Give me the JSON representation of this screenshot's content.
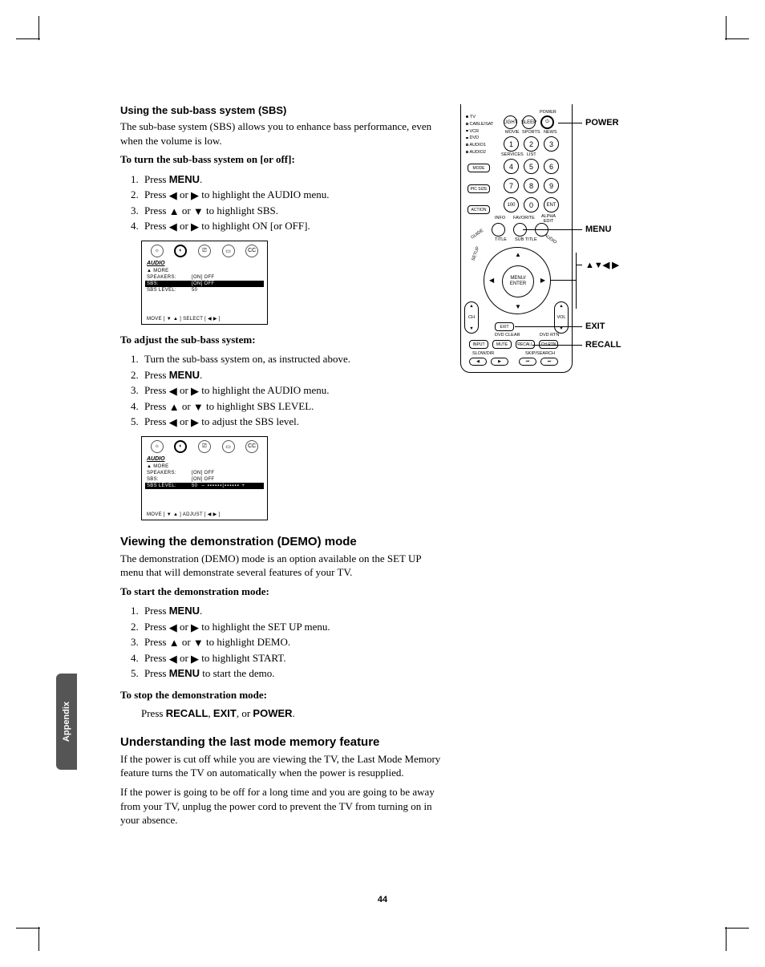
{
  "side_tab": "Appendix",
  "page_number": "44",
  "sbs": {
    "heading": "Using the sub-bass system (SBS)",
    "intro": "The sub-base system (SBS) allows you to enhance bass performance, even when the volume is low.",
    "turn_on_lead": "To turn the sub-bass system on [or off]:",
    "steps_on": {
      "s1a": "Press ",
      "s1b": "MENU",
      "s1c": ".",
      "s2a": "Press ",
      "s2b": " or ",
      "s2c": " to highlight the AUDIO menu.",
      "s3a": "Press ",
      "s3b": " or ",
      "s3c": " to highlight SBS.",
      "s4a": "Press ",
      "s4b": " or ",
      "s4c": " to highlight ON [or OFF]."
    },
    "adjust_lead": "To adjust the sub-bass system:",
    "steps_adj": {
      "s1": "Turn the sub-bass system on, as instructed above.",
      "s2a": "Press ",
      "s2b": "MENU",
      "s2c": ".",
      "s3a": "Press ",
      "s3b": " or ",
      "s3c": " to highlight the AUDIO menu.",
      "s4a": "Press ",
      "s4b": " or ",
      "s4c": " to highlight SBS LEVEL.",
      "s5a": "Press ",
      "s5b": " or ",
      "s5c": " to adjust the SBS level."
    }
  },
  "menu1": {
    "title": "AUDIO",
    "more": "▲ MORE",
    "r1l": "SPEAKERS:",
    "r1v": "[ON] OFF",
    "r2l": "SBS:",
    "r2v": "[ON] OFF",
    "r3l": "SBS LEVEL:",
    "r3v": "50",
    "foot": "MOVE [ ▼ ▲ ]   SELECT [ ◀ ▶ ]"
  },
  "menu2": {
    "title": "AUDIO",
    "more": "▲ MORE",
    "r1l": "SPEAKERS:",
    "r1v": "[ON] OFF",
    "r2l": "SBS:",
    "r2v": "[ON] OFF",
    "r3l": "SBS LEVEL:",
    "r3v": "50",
    "foot": "MOVE [ ▼ ▲ ]   ADJUST [ ◀ ▶ ]"
  },
  "demo": {
    "heading": "Viewing the demonstration (DEMO) mode",
    "intro": "The demonstration (DEMO) mode is an option available on the SET UP menu that will demonstrate several features of your TV.",
    "start_lead": "To start the demonstration mode:",
    "steps": {
      "s1a": "Press ",
      "s1b": "MENU",
      "s1c": ".",
      "s2a": "Press ",
      "s2b": " or ",
      "s2c": " to highlight the SET UP menu.",
      "s3a": "Press ",
      "s3b": " or ",
      "s3c": " to highlight DEMO.",
      "s4a": "Press ",
      "s4b": " or ",
      "s4c": " to highlight START.",
      "s5a": "Press ",
      "s5b": "MENU",
      "s5c": " to start the demo."
    },
    "stop_lead": "To stop the demonstration mode:",
    "stop_a": "Press  ",
    "stop_b": "RECALL",
    "stop_c": ", ",
    "stop_d": "EXIT",
    "stop_e": ", or ",
    "stop_f": "POWER",
    "stop_g": "."
  },
  "lastmode": {
    "heading": "Understanding the last mode memory feature",
    "p1": "If the power is cut off while you are viewing the TV, the Last Mode Memory feature turns the TV on automatically when the power is resupplied.",
    "p2": "If the power is going to be off for a long time and you are going to be away from your TV, unplug the power cord to prevent the TV from turning on in your absence."
  },
  "remote": {
    "callout_power": "POWER",
    "callout_menu": "MENU",
    "callout_arrows": "▲▼◀ ▶",
    "callout_exit": "EXIT",
    "callout_recall": "RECALL",
    "modes": {
      "tv": "TV",
      "cbl": "CABLE/SAT",
      "vcr": "VCR",
      "dvd": "DVD",
      "a1": "AUDIO1",
      "a2": "AUDIO2"
    },
    "labels": {
      "power": "POWER",
      "light": "LIGHT",
      "sleep": "SLEEP",
      "movie": "MOVIE",
      "sports": "SPORTS",
      "news": "NEWS",
      "services": "SERVICES",
      "list": "LIST",
      "mode": "MODE",
      "picsize": "PIC SIZE",
      "action": "ACTION",
      "info": "INFO",
      "favorite": "FAVORITE",
      "alpha": "ALPHA\nEDIT",
      "guide": "GUIDE",
      "title": "TITLE",
      "subtitle": "SUB TITLE",
      "audio": "AUDIO",
      "setup": "SETUP",
      "menu": "MENU/\nENTER",
      "exit": "EXIT",
      "dvdclear": "DVD CLEAR",
      "dvdrtn": "DVD RTN",
      "input": "INPUT",
      "mute": "MUTE",
      "recall": "RECALL",
      "chrtn": "CH RTN",
      "slow": "SLOW/DIR",
      "skip": "SKIP/SEARCH",
      "ch": "CH",
      "vol": "VOL"
    },
    "nums": {
      "n1": "1",
      "n2": "2",
      "n3": "3",
      "n4": "4",
      "n5": "5",
      "n6": "6",
      "n7": "7",
      "n8": "8",
      "n9": "9",
      "n100": "100",
      "n0": "0",
      "ent": "ENT"
    }
  }
}
